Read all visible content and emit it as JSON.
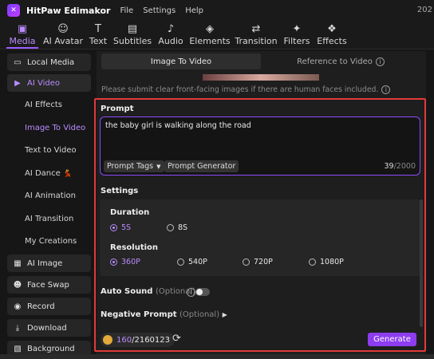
{
  "app": {
    "title": "HitPaw Edimakor",
    "clock": "202"
  },
  "menu": [
    "File",
    "Settings",
    "Help"
  ],
  "toolbar": [
    {
      "label": "Media",
      "icon": "media-icon",
      "glyph": "▣",
      "active": true
    },
    {
      "label": "AI Avatar",
      "icon": "avatar-icon",
      "glyph": "☺"
    },
    {
      "label": "Text",
      "icon": "text-icon",
      "glyph": "T"
    },
    {
      "label": "Subtitles",
      "icon": "subtitles-icon",
      "glyph": "▤"
    },
    {
      "label": "Audio",
      "icon": "audio-icon",
      "glyph": "♪"
    },
    {
      "label": "Elements",
      "icon": "elements-icon",
      "glyph": "◈"
    },
    {
      "label": "Transition",
      "icon": "transition-icon",
      "glyph": "⇄"
    },
    {
      "label": "Filters",
      "icon": "filters-icon",
      "glyph": "✦"
    },
    {
      "label": "Effects",
      "icon": "effects-icon",
      "glyph": "❖"
    }
  ],
  "sidebar": {
    "local_media": "Local Media",
    "ai_video": "AI Video",
    "sub": [
      "AI Effects",
      "Image To Video",
      "Text to Video",
      "AI Dance",
      "AI Animation",
      "AI Transition",
      "My Creations"
    ],
    "dance_emoji": "💃",
    "ai_image": "AI Image",
    "face_swap": "Face Swap",
    "record": "Record",
    "download": "Download",
    "background": "Background"
  },
  "tabs": {
    "image_to_video": "Image To Video",
    "reference_to_video": "Reference to Video"
  },
  "notice": "Please submit clear front-facing images if there are human faces included.",
  "prompt": {
    "title": "Prompt",
    "text": "the baby girl is walking along the road",
    "tags_label": "Prompt Tags",
    "generator_label": "Prompt Generator",
    "count": "39",
    "max": "/2000"
  },
  "settings": {
    "title": "Settings",
    "duration_label": "Duration",
    "durations": [
      "5S",
      "8S"
    ],
    "duration_selected": "5S",
    "resolution_label": "Resolution",
    "resolutions": [
      "360P",
      "540P",
      "720P",
      "1080P"
    ],
    "resolution_selected": "360P"
  },
  "auto_sound": {
    "label": "Auto Sound",
    "optional": "(Optional)",
    "enabled": false
  },
  "negative_prompt": {
    "label": "Negative Prompt",
    "optional": "(Optional)"
  },
  "credits": {
    "used": "160",
    "total": "/2160123"
  },
  "generate_label": "Generate",
  "colors": {
    "accent": "#9b5cff",
    "highlight": "#e23a3a",
    "generate": "#8d3cf0"
  }
}
